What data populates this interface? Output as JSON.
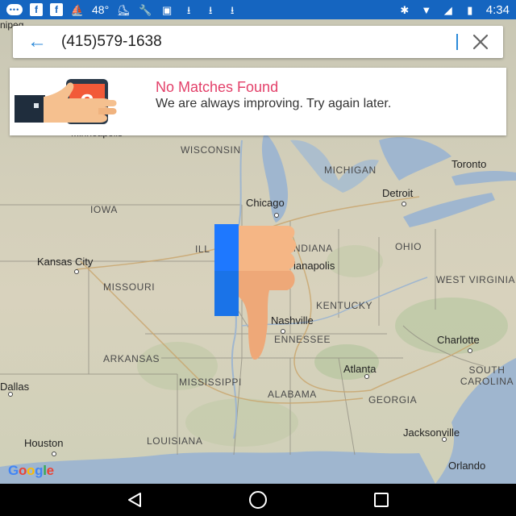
{
  "status_bar": {
    "temperature": "48°",
    "time": "4:34"
  },
  "search": {
    "query": "(415)579-1638",
    "back_icon": "arrow-back-icon",
    "clear_icon": "close-icon"
  },
  "result_card": {
    "title": "No Matches Found",
    "message": "We are always improving. Try again later.",
    "illustration": "phone-question-icon"
  },
  "map": {
    "states": [
      "WISCONSIN",
      "MICHIGAN",
      "IOWA",
      "ILL",
      "INDIANA",
      "OHIO",
      "MISSOURI",
      "WEST VIRGINIA",
      "KENTUCKY",
      "ENNESSEE",
      "ARKANSAS",
      "MISSISSIPPI",
      "ALABAMA",
      "GEORGIA",
      "SOUTH CAROLINA",
      "LOUISIANA"
    ],
    "cities": [
      "Chicago",
      "Detroit",
      "Toronto",
      "Kansas City",
      "ianapolis",
      "Nashville",
      "Charlotte",
      "Atlanta",
      "Dallas",
      "Houston",
      "Jacksonville",
      "Orlando",
      "Minneapolis",
      "nipeg"
    ],
    "attribution": "Google"
  },
  "colors": {
    "status_bar": "#1565c0",
    "accent": "#2c8ad9",
    "title_pink": "#e3416a"
  }
}
